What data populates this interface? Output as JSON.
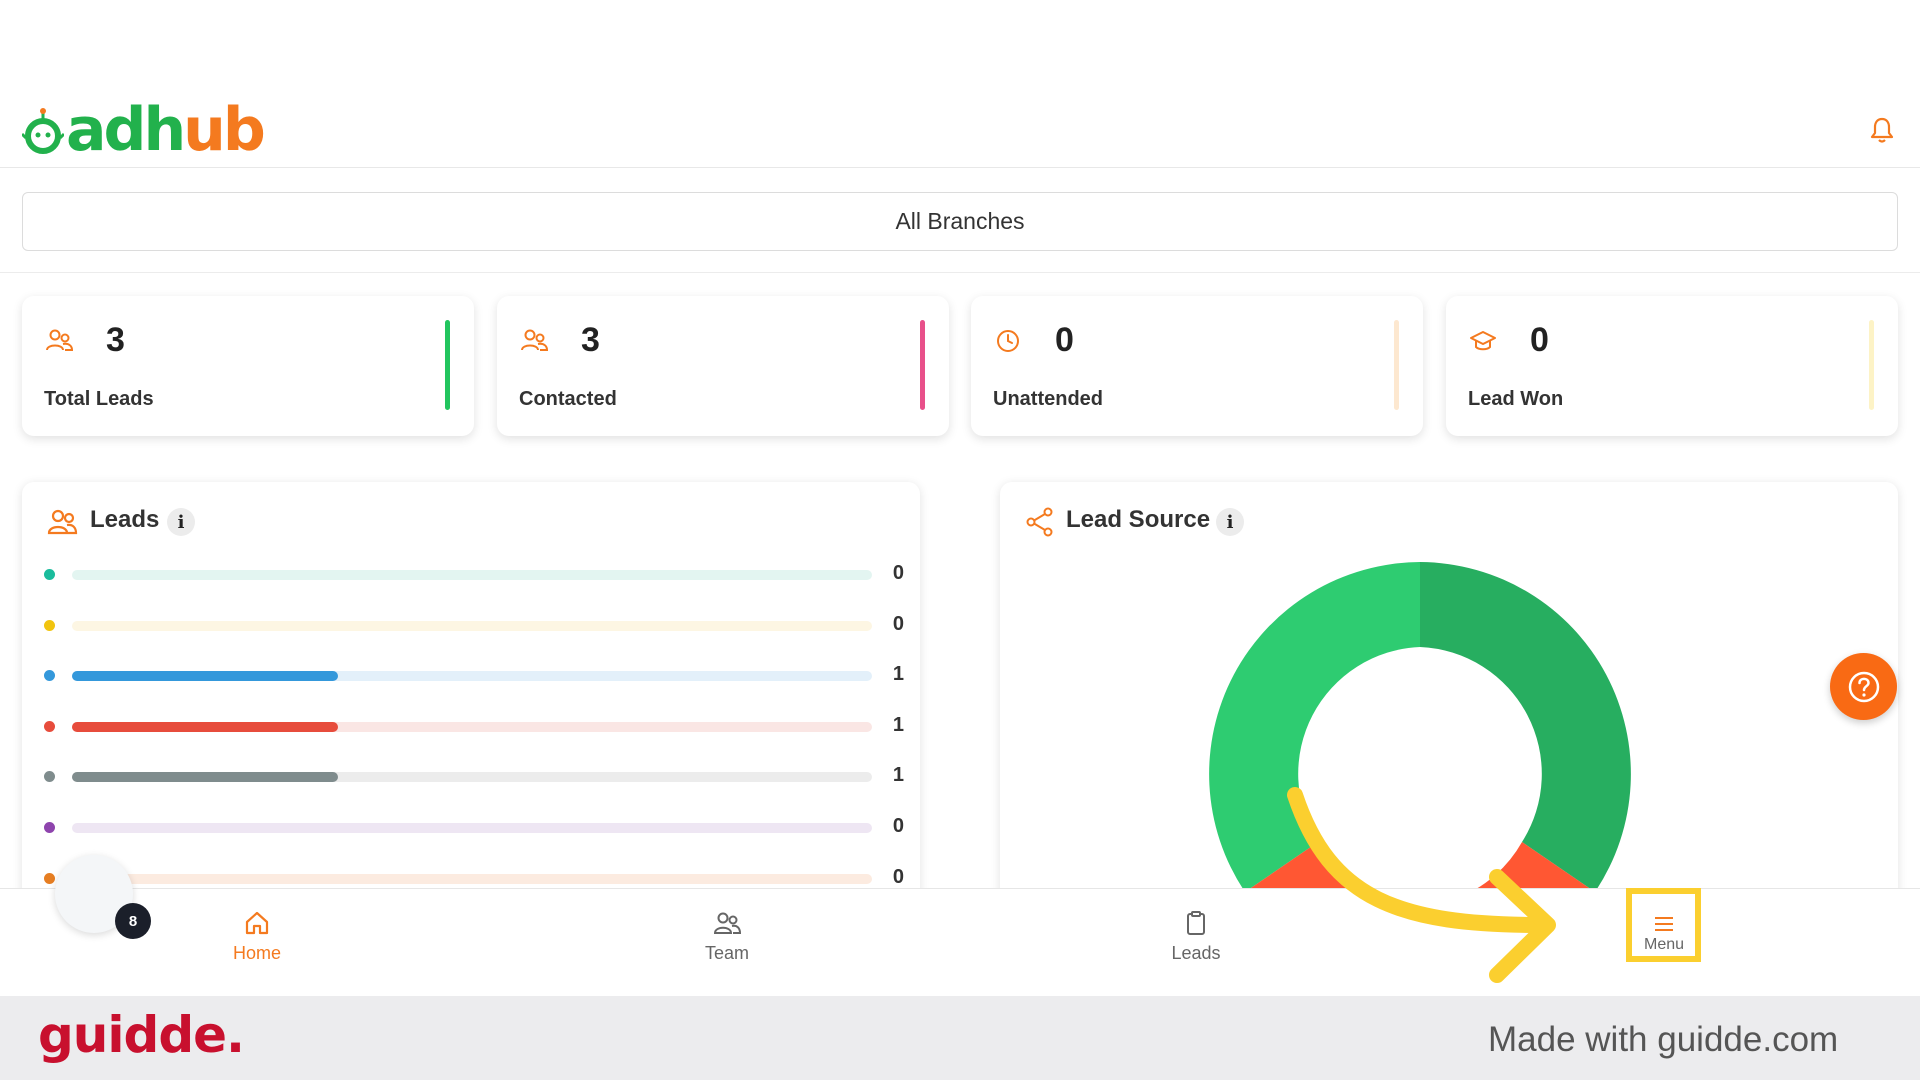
{
  "header": {
    "logo_green": "adh",
    "logo_orange": "ub"
  },
  "branch": {
    "label": "All Branches"
  },
  "stats": [
    {
      "value": "3",
      "label": "Total Leads",
      "icon": "users-icon",
      "accent": "#22c55e"
    },
    {
      "value": "3",
      "label": "Contacted",
      "icon": "users-icon",
      "accent": "#e8508a"
    },
    {
      "value": "0",
      "label": "Unattended",
      "icon": "clock-icon",
      "accent": "#fde8d0"
    },
    {
      "value": "0",
      "label": "Lead Won",
      "icon": "graduation-cap-icon",
      "accent": "#fdf3c6"
    }
  ],
  "leads_panel": {
    "title": "Leads",
    "info": "i",
    "rows": [
      {
        "color": "#1abc9c",
        "track": "#e3f5f1",
        "fraction": 0,
        "count": "0"
      },
      {
        "color": "#f1c40f",
        "track": "#fdf6e3",
        "fraction": 0,
        "count": "0"
      },
      {
        "color": "#3498db",
        "track": "#e3f0fa",
        "fraction": 0.333,
        "count": "1"
      },
      {
        "color": "#e74c3c",
        "track": "#fae6e4",
        "fraction": 0.333,
        "count": "1"
      },
      {
        "color": "#7f8c8d",
        "track": "#ececec",
        "fraction": 0.333,
        "count": "1"
      },
      {
        "color": "#8e44ad",
        "track": "#eee6f3",
        "fraction": 0,
        "count": "0"
      },
      {
        "color": "#e67e22",
        "track": "#fcebe0",
        "fraction": 0,
        "count": "0"
      }
    ]
  },
  "source_panel": {
    "title": "Lead Source",
    "info": "i",
    "donut_colors": [
      "#27ae60",
      "#2ecc71",
      "#ff5733"
    ]
  },
  "nav": {
    "home": "Home",
    "team": "Team",
    "leads": "Leads",
    "menu": "Menu"
  },
  "avatar": {
    "badge": "8"
  },
  "footer": {
    "brand": "guidde.",
    "made_with": "Made with guidde.com"
  },
  "colors": {
    "brand_orange": "#f47a1f",
    "brand_green": "#22b14c",
    "highlight_yellow": "#fbcf2f"
  }
}
